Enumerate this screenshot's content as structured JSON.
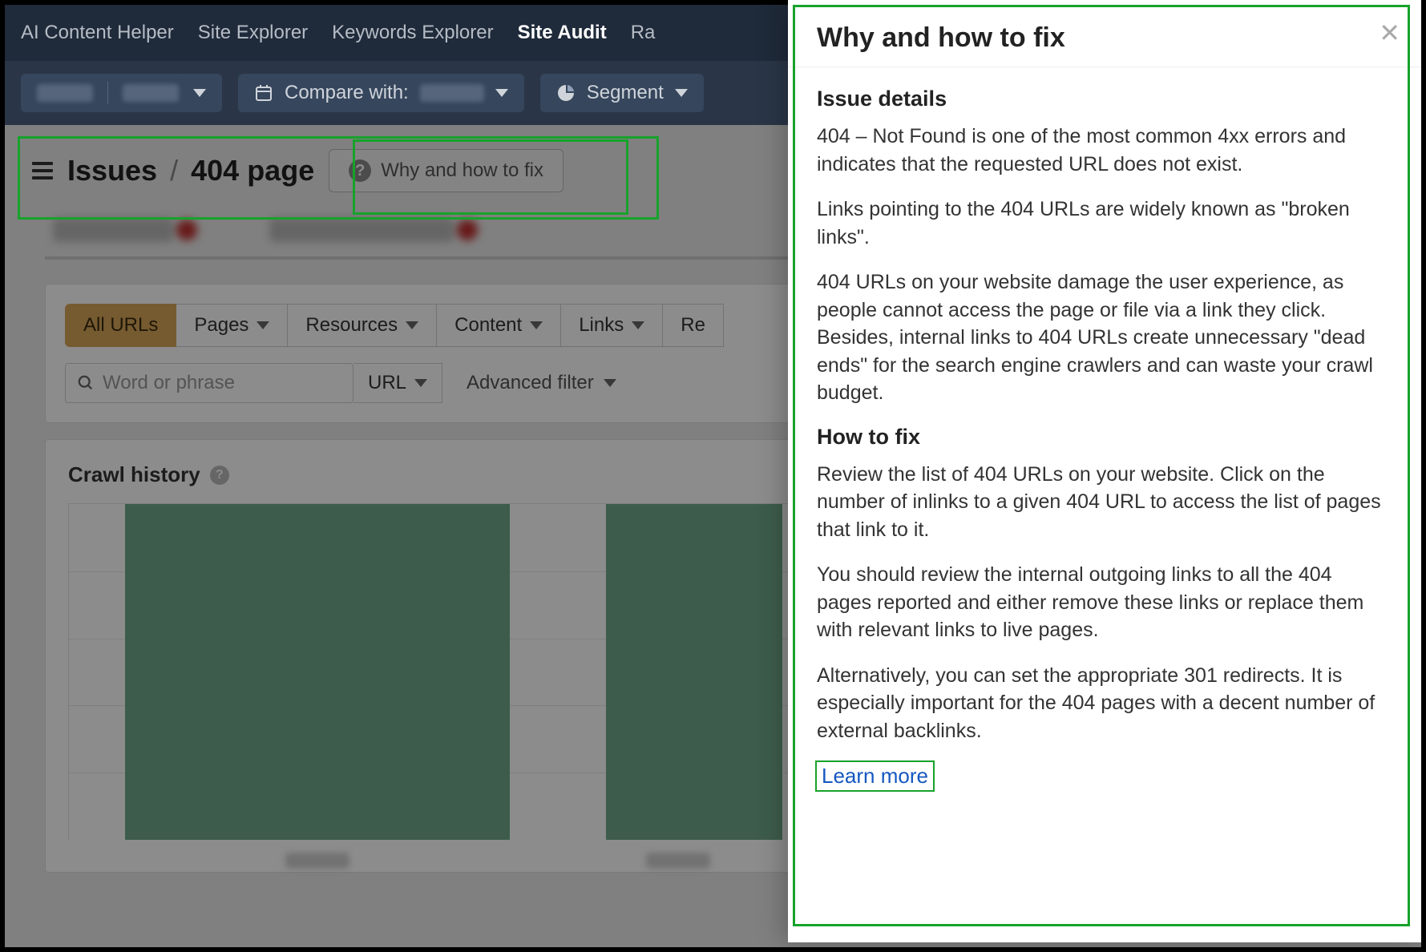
{
  "nav": {
    "items": [
      "AI Content Helper",
      "Site Explorer",
      "Keywords Explorer",
      "Site Audit",
      "Ra"
    ],
    "active_index": 3
  },
  "subbar": {
    "compare_label": "Compare with:",
    "segment_label": "Segment"
  },
  "breadcrumb": {
    "root": "Issues",
    "page": "404 page"
  },
  "why_button_label": "Why and how to fix",
  "filters": {
    "row1": [
      "All URLs",
      "Pages",
      "Resources",
      "Content",
      "Links",
      "Re"
    ],
    "active_index": 0,
    "search_placeholder": "Word or phrase",
    "url_selector": "URL",
    "advanced_label": "Advanced filter"
  },
  "crawl": {
    "title": "Crawl history"
  },
  "chart_data": {
    "type": "bar",
    "categories": [
      "",
      "",
      ""
    ],
    "values": [
      100,
      100,
      100
    ],
    "ylim": [
      0,
      100
    ],
    "title": "",
    "xlabel": "",
    "ylabel": ""
  },
  "panel": {
    "title": "Why and how to fix",
    "section1_title": "Issue details",
    "p1": "404 – Not Found is one of the most common 4xx errors and indicates that the requested URL does not exist.",
    "p2": "Links pointing to the 404 URLs are widely known as \"broken links\".",
    "p3": "404 URLs on your website damage the user experience, as people cannot access the page or file via a link they click. Besides, internal links to 404 URLs create unnecessary \"dead ends\" for the search engine crawlers and can waste your crawl budget.",
    "section2_title": "How to fix",
    "p4": "Review the list of 404 URLs on your website. Click on the number of inlinks to a given 404 URL to access the list of pages that link to it.",
    "p5": "You should review the internal outgoing links to all the 404 pages reported and either remove these links or replace them with relevant links to live pages.",
    "p6": "Alternatively, you can set the appropriate 301 redirects. It is especially important for the 404 pages with a decent number of external backlinks.",
    "learn_more": "Learn more"
  }
}
